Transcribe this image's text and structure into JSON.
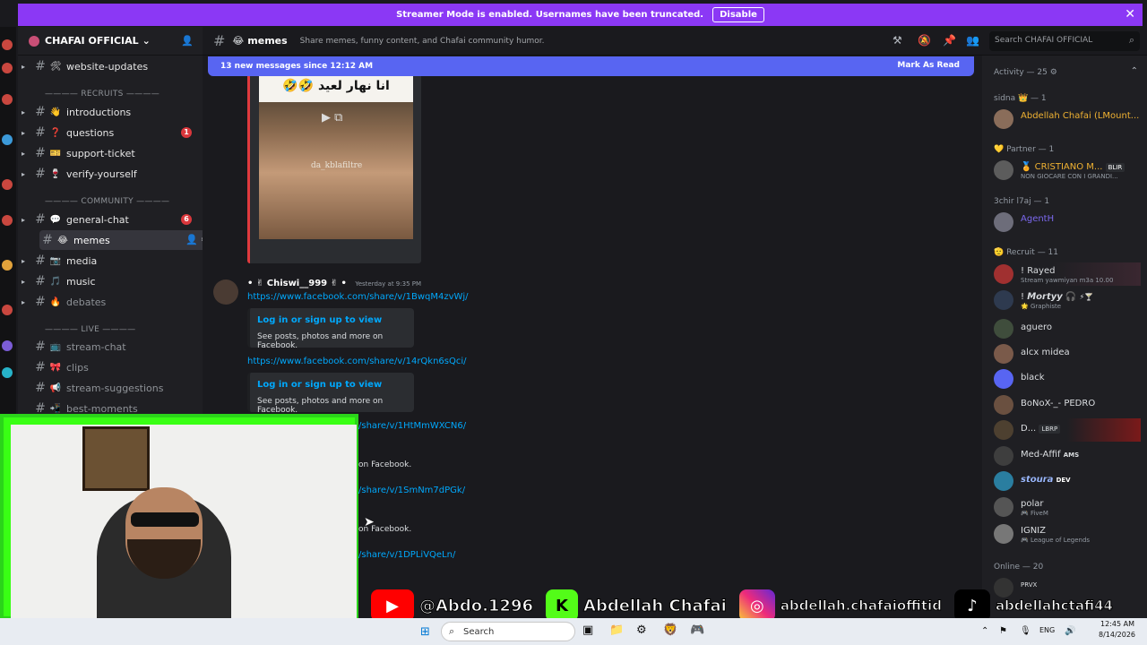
{
  "banner": {
    "text": "Streamer Mode is enabled. Usernames have been truncated.",
    "disable_label": "Disable",
    "close": "✕"
  },
  "server": {
    "name": "CHAFAI OFFICIAL",
    "chevron": "⌄"
  },
  "channels": [
    {
      "name": "website-updates",
      "emoji": "🛠",
      "badge": ""
    },
    {
      "name": "introductions",
      "emoji": "👋",
      "badge": ""
    },
    {
      "name": "questions",
      "emoji": "❓",
      "badge": "1"
    },
    {
      "name": "support-ticket",
      "emoji": "🎫",
      "badge": ""
    },
    {
      "name": "verify-yourself",
      "emoji": "🍷",
      "badge": ""
    },
    {
      "name": "general-chat",
      "emoji": "💬",
      "badge": "6"
    },
    {
      "name": "memes",
      "emoji": "😂",
      "badge": ""
    },
    {
      "name": "media",
      "emoji": "📷",
      "badge": ""
    },
    {
      "name": "music",
      "emoji": "🎵",
      "badge": ""
    },
    {
      "name": "debates",
      "emoji": "🔥",
      "badge": ""
    },
    {
      "name": "stream-chat",
      "emoji": "📺",
      "badge": ""
    },
    {
      "name": "clips",
      "emoji": "🎀",
      "badge": ""
    },
    {
      "name": "stream-suggestions",
      "emoji": "📢",
      "badge": ""
    },
    {
      "name": "best-moments",
      "emoji": "📲",
      "badge": ""
    }
  ],
  "categories": {
    "recruits": "———— RECRUITS ————",
    "community": "———— COMMUNITY ————",
    "live": "———— LIVE ————"
  },
  "header": {
    "channel": "memes",
    "emoji": "😂",
    "topic": "Share memes, funny content, and Chafai community humor.",
    "search_placeholder": "Search CHAFAI OFFICIAL"
  },
  "new_messages": {
    "text": "13 new messages since 12:12 AM",
    "mark_read": "Mark As Read"
  },
  "embed": {
    "overlay_text": "انا نهار لعيد 🤣🤣",
    "watermark": "da_kblafiltre"
  },
  "message": {
    "author": "• ✌ Chiswi__999 ✌ •",
    "timestamp": "Yesterday at 9:35 PM",
    "links": [
      "https://www.facebook.com/share/v/1BwqM4zvWj/",
      "https://www.facebook.com/share/v/14rQkn6sQci/",
      "/share/v/1HtMmWXCN6/",
      "/share/v/1SmNm7dPGk/",
      "/share/v/1DPLiVQeLn/"
    ],
    "card_title": "Log in or sign up to view",
    "card_desc": "See posts, photos and more on Facebook.",
    "card_desc_partial": "on Facebook."
  },
  "members": {
    "activity": "Activity — 25",
    "groups": [
      {
        "title": "sidna 👑 — 1",
        "members": [
          {
            "name": "Abdellah Chafai (LMount...",
            "status": "",
            "color": "#f0b232"
          }
        ]
      },
      {
        "title": "💛 Partner — 1",
        "members": [
          {
            "name": "🏅 CRISTIANO M...",
            "status": "NON GIOCARE CON I GRANDI...",
            "color": "#f0b232",
            "tag": "BLIR"
          }
        ]
      },
      {
        "title": "3chir l7aj — 1",
        "members": [
          {
            "name": "AgentH",
            "status": "",
            "color": "#7b68ee"
          }
        ]
      },
      {
        "title": "🫡 Recruit — 11",
        "members": [
          {
            "name": "! Rayed",
            "status": "Stream yawmiyan m3a 10.00",
            "color": "#dbdee1"
          },
          {
            "name": "! 𝙈𝙤𝙧𝙩𝙮𝙮 🎧",
            "status": "🌟 Graphiste",
            "color": "#dbdee1",
            "tag": "⚡🍸"
          },
          {
            "name": "aguero",
            "status": "",
            "color": "#dbdee1"
          },
          {
            "name": "alcx midea",
            "status": "",
            "color": "#dbdee1"
          },
          {
            "name": "black",
            "status": "",
            "color": "#dbdee1"
          },
          {
            "name": "BoNoX-_- PEDRO",
            "status": "",
            "color": "#dbdee1"
          },
          {
            "name": "D...",
            "status": "",
            "color": "#dbdee1",
            "tag": "LBRP"
          },
          {
            "name": "Med-Affif",
            "status": "",
            "color": "#dbdee1",
            "tag": "AMS"
          },
          {
            "name": "𝙨𝙩𝙤𝙪𝙧𝙖",
            "status": "",
            "color": "#9ab8ff",
            "tag": "DEV"
          },
          {
            "name": "polar",
            "status": "🎮 FiveM",
            "color": "#dbdee1"
          },
          {
            "name": "IGNIZ",
            "status": "🎮 League of Legends",
            "color": "#dbdee1"
          }
        ]
      },
      {
        "title": "Online — 20",
        "members": [
          {
            "name": "",
            "status": "",
            "color": "#dbdee1",
            "tag": "PRVX"
          }
        ]
      }
    ]
  },
  "social": {
    "youtube": "@Abdo.1296",
    "kick": "Abdellah Chafai",
    "instagram": "abdellah.chafaioffitid",
    "tiktok": "abdellahctafi44"
  },
  "taskbar": {
    "search": "Search",
    "lang": "ENG",
    "time": "12:45 AM",
    "date": "8/14/2026"
  }
}
